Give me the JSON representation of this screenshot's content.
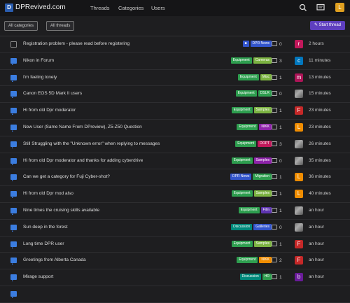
{
  "header": {
    "logo_letter": "D",
    "site_title": "DPRevived.com",
    "nav": [
      "Threads",
      "Categories",
      "Users"
    ],
    "user_initial": "L"
  },
  "filters": {
    "categories_label": "All categories",
    "threads_label": "All threads",
    "start_label": "Start thread"
  },
  "threads": [
    {
      "icon": "doc",
      "title": "Registration problem - please read before registering",
      "tags": [
        {
          "text": "■",
          "color": "#3355cc"
        },
        {
          "text": "DPR News",
          "color": "#3355cc"
        }
      ],
      "replies": "0",
      "avatar": {
        "letter": "r",
        "color": "#c2185b"
      },
      "time": "2 hours"
    },
    {
      "icon": "chat",
      "title": "Nikon in Forum",
      "tags": [
        {
          "text": "Equipment",
          "color": "#2e9e4f"
        },
        {
          "text": "Cameras",
          "color": "#7cb342"
        }
      ],
      "replies": "3",
      "avatar": {
        "letter": "c",
        "color": "#0277bd"
      },
      "time": "11 minutes"
    },
    {
      "icon": "chat",
      "title": "I'm feeling lonely",
      "tags": [
        {
          "text": "Equipment",
          "color": "#2e9e4f"
        },
        {
          "text": "Misc",
          "color": "#7cb342"
        }
      ],
      "replies": "1",
      "avatar": {
        "letter": "m",
        "color": "#ad1457"
      },
      "time": "13 minutes"
    },
    {
      "icon": "chat",
      "title": "Canon EOS 5D Mark II users",
      "tags": [
        {
          "text": "Equipment",
          "color": "#2e9e4f"
        },
        {
          "text": "DSLR",
          "color": "#2e9e4f"
        }
      ],
      "replies": "0",
      "avatar": {
        "letter": "",
        "color": ""
      },
      "time": "15 minutes"
    },
    {
      "icon": "chat",
      "title": "Hi from old Dpr moderator",
      "tags": [
        {
          "text": "Equipment",
          "color": "#2e9e4f"
        },
        {
          "text": "Samples",
          "color": "#7cb342"
        }
      ],
      "replies": "1",
      "avatar": {
        "letter": "F",
        "color": "#c62828"
      },
      "time": "23 minutes"
    },
    {
      "icon": "chat",
      "title": "New User (Same Name From DPreview), Z5-Z50 Question",
      "tags": [
        {
          "text": "Equipment",
          "color": "#2e9e4f"
        },
        {
          "text": "NIKK",
          "color": "#8e24aa"
        }
      ],
      "replies": "1",
      "avatar": {
        "letter": "L",
        "color": "#ef8c00"
      },
      "time": "23 minutes"
    },
    {
      "icon": "chat",
      "title": "Still Struggling with the \"Unknown error\" when replying to messages",
      "tags": [
        {
          "text": "Equipment",
          "color": "#2e9e4f"
        },
        {
          "text": "DOPT",
          "color": "#c2185b"
        }
      ],
      "replies": "3",
      "avatar": {
        "letter": "",
        "color": ""
      },
      "time": "26 minutes"
    },
    {
      "icon": "chat",
      "title": "Hi from old Dpr moderator and thanks for adding cyberdrive",
      "tags": [
        {
          "text": "Equipment",
          "color": "#2e9e4f"
        },
        {
          "text": "Samples",
          "color": "#8e24aa"
        }
      ],
      "replies": "0",
      "avatar": {
        "letter": "",
        "color": ""
      },
      "time": "35 minutes"
    },
    {
      "icon": "chat",
      "title": "Can we get a category for Fuji Cyber-shot?",
      "tags": [
        {
          "text": "DPR News",
          "color": "#3355cc"
        },
        {
          "text": "Migration",
          "color": "#2e9e4f"
        }
      ],
      "replies": "1",
      "avatar": {
        "letter": "L",
        "color": "#ef8c00"
      },
      "time": "36 minutes"
    },
    {
      "icon": "chat",
      "title": "Hi from old Dpr mod also",
      "tags": [
        {
          "text": "Equipment",
          "color": "#2e9e4f"
        },
        {
          "text": "Samples",
          "color": "#7cb342"
        }
      ],
      "replies": "1",
      "avatar": {
        "letter": "L",
        "color": "#ef8c00"
      },
      "time": "40 minutes"
    },
    {
      "icon": "chat",
      "title": "Nine times the cruising skills available",
      "tags": [
        {
          "text": "Equipment",
          "color": "#2e9e4f"
        },
        {
          "text": "Film",
          "color": "#5e35b1"
        }
      ],
      "replies": "1",
      "avatar": {
        "letter": "",
        "color": ""
      },
      "time": "an hour"
    },
    {
      "icon": "chat",
      "title": "Sun deep in the forest",
      "tags": [
        {
          "text": "Discussion",
          "color": "#00897b"
        },
        {
          "text": "Galleries",
          "color": "#3355cc"
        }
      ],
      "replies": "0",
      "avatar": {
        "letter": "",
        "color": ""
      },
      "time": "an hour"
    },
    {
      "icon": "chat",
      "title": "Long time DPR user",
      "tags": [
        {
          "text": "Equipment",
          "color": "#2e9e4f"
        },
        {
          "text": "Samples",
          "color": "#7cb342"
        }
      ],
      "replies": "1",
      "avatar": {
        "letter": "F",
        "color": "#c62828"
      },
      "time": "an hour"
    },
    {
      "icon": "chat",
      "title": "Greetings from Alberta Canada",
      "tags": [
        {
          "text": "Equipment",
          "color": "#2e9e4f"
        },
        {
          "text": "NIKK",
          "color": "#ef8c00"
        }
      ],
      "replies": "2",
      "avatar": {
        "letter": "F",
        "color": "#c62828"
      },
      "time": "an hour"
    },
    {
      "icon": "chat",
      "title": "Mirage support",
      "tags": [
        {
          "text": "Discussion",
          "color": "#00897b"
        },
        {
          "text": "HR",
          "color": "#2e9e4f"
        }
      ],
      "replies": "1",
      "avatar": {
        "letter": "b",
        "color": "#6a1b9a"
      },
      "time": "an hour"
    },
    {
      "icon": "chat",
      "title": "",
      "tags": [],
      "replies": "",
      "avatar": {
        "letter": "",
        "color": ""
      },
      "time": ""
    }
  ]
}
